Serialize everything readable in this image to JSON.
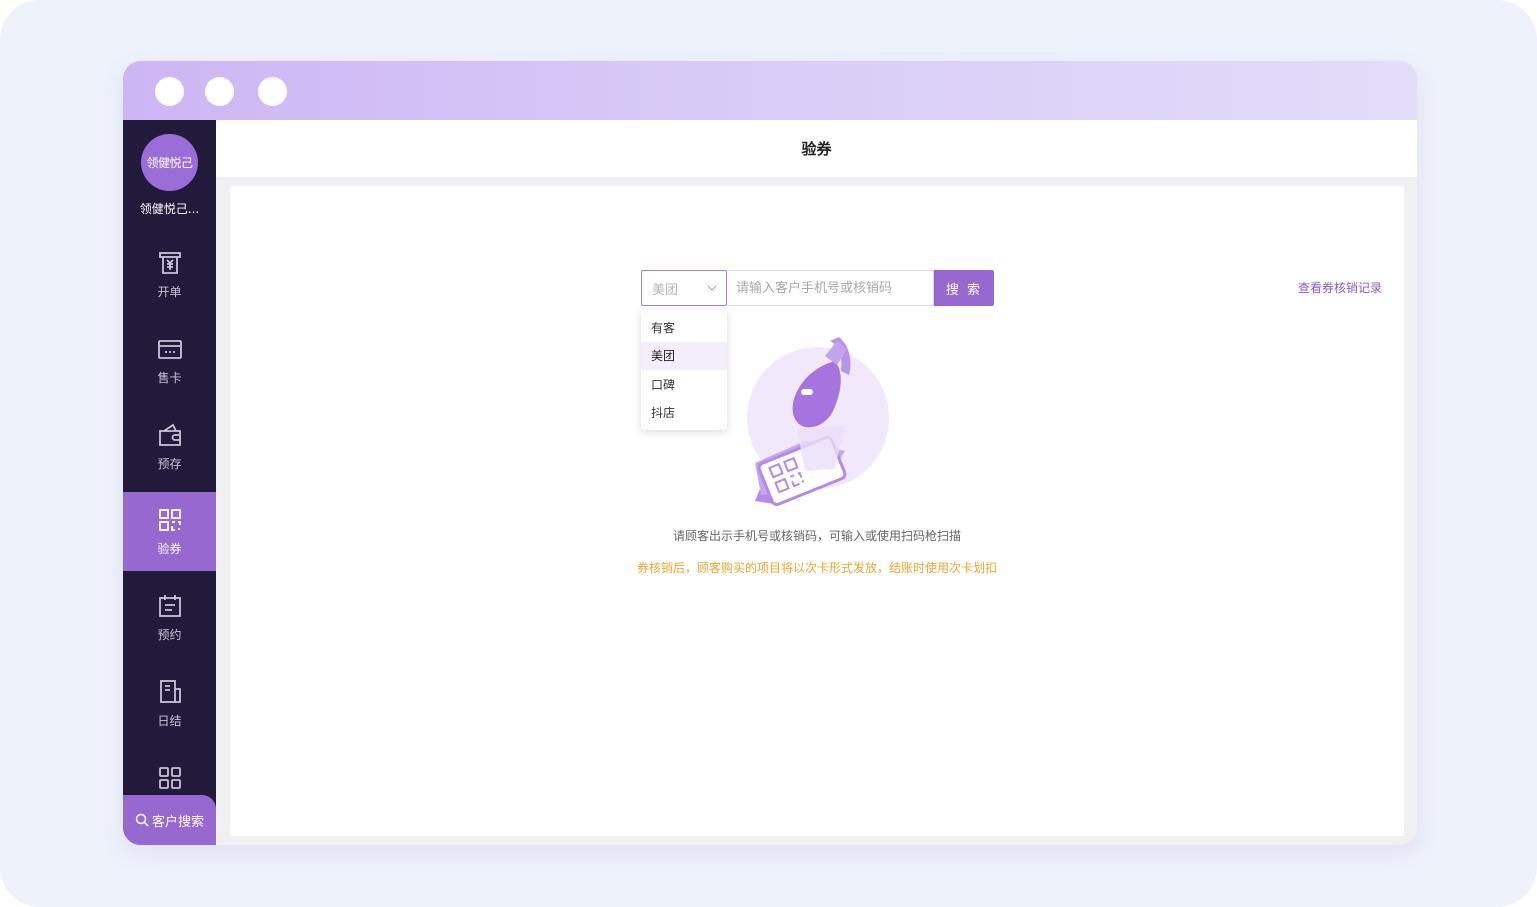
{
  "sidebar": {
    "avatar_text": "领健悦己",
    "store_name": "领健悦己...",
    "items": [
      {
        "label": "开单",
        "icon": "receipt-yuan-icon"
      },
      {
        "label": "售卡",
        "icon": "card-icon"
      },
      {
        "label": "预存",
        "icon": "wallet-icon"
      },
      {
        "label": "验券",
        "icon": "qrcode-icon",
        "active": true
      },
      {
        "label": "预约",
        "icon": "calendar-icon"
      },
      {
        "label": "日结",
        "icon": "ledger-icon"
      },
      {
        "label": "",
        "icon": "grid-icon"
      }
    ],
    "customer_search": "客户搜索"
  },
  "header": {
    "title": "验券"
  },
  "search": {
    "platform_selected": "美团",
    "placeholder": "请输入客户手机号或核销码",
    "button_label": "搜 索",
    "options": [
      "有客",
      "美团",
      "口碑",
      "抖店"
    ]
  },
  "record_link": "查看券核销记录",
  "hint_text": "请顾客出示手机号或核销码，可输入或使用扫码枪扫描",
  "notice_text": "券核销后，顾客购买的项目将以次卡形式发放，结账时使用次卡划扣",
  "colors": {
    "accent": "#9668d0",
    "sidebar_bg": "#221a3a",
    "notice": "#f0a630"
  }
}
